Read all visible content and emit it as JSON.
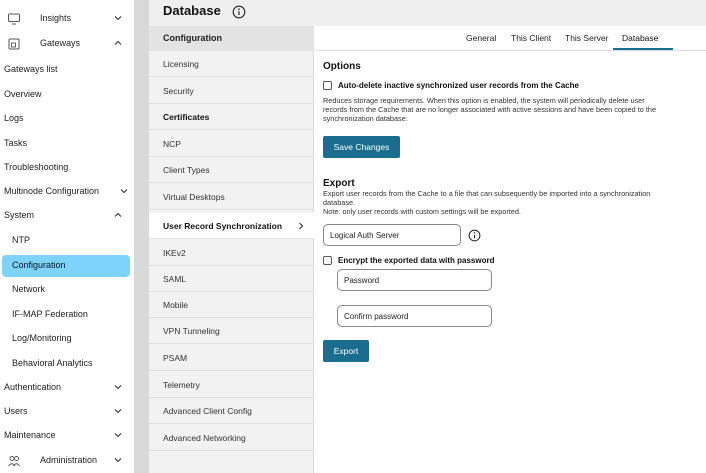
{
  "nav": {
    "items": [
      {
        "label": "Insights",
        "has_icon": true
      },
      {
        "label": "Gateways",
        "has_icon": true
      },
      {
        "label": "Gateways list"
      },
      {
        "label": "Overview"
      },
      {
        "label": "Logs"
      },
      {
        "label": "Tasks"
      },
      {
        "label": "Troubleshooting"
      },
      {
        "label": "Multinode Configuration"
      },
      {
        "label": "System"
      },
      {
        "label": "NTP"
      },
      {
        "label": "Configuration"
      },
      {
        "label": "Network"
      },
      {
        "label": "IF-MAP Federation"
      },
      {
        "label": "Log/Monitoring"
      },
      {
        "label": "Behavioral Analytics"
      },
      {
        "label": "Authentication"
      },
      {
        "label": "Users"
      },
      {
        "label": "Maintenance"
      },
      {
        "label": "Administration",
        "has_icon": true
      }
    ],
    "active_color": "#7dd3fc"
  },
  "header": {
    "title": "Database"
  },
  "config": {
    "heading": "Configuration",
    "items": [
      {
        "label": "Licensing"
      },
      {
        "label": "Security"
      },
      {
        "label": "Certificates"
      },
      {
        "label": "NCP"
      },
      {
        "label": "Client Types"
      },
      {
        "label": "Virtual Desktops"
      },
      {
        "label": "User Record Synchronization"
      },
      {
        "label": "IKEv2"
      },
      {
        "label": "SAML"
      },
      {
        "label": "Mobile"
      },
      {
        "label": "VPN Tunneling"
      },
      {
        "label": "PSAM"
      },
      {
        "label": "Telemetry"
      },
      {
        "label": "Advanced Client Config"
      },
      {
        "label": "Advanced Networking"
      }
    ]
  },
  "tabs": [
    {
      "label": "General"
    },
    {
      "label": "This Client"
    },
    {
      "label": "This Server"
    },
    {
      "label": "Database"
    }
  ],
  "options": {
    "title": "Options",
    "checkbox_label": "Auto-delete inactive synchronized user records from the Cache",
    "desc1": "Reduces storage requirements. When this option is enabled, the system will periodically delete user",
    "desc2": "records from the Cache that are no longer associated with active sessions and have been copied to the",
    "desc3": "synchronization database.",
    "save_label": "Save Changes"
  },
  "export": {
    "title": "Export",
    "desc1": "Export user records from the Cache to a file that can subsequently be imported into a synchronization",
    "desc2": "database.",
    "desc3": "Note: only user records with custom settings will be exported.",
    "server_value": "Logical Auth Server",
    "encrypt_label": "Encrypt the exported data with password",
    "password_label": "Password",
    "confirm_label": "Confirm password",
    "export_label": "Export"
  },
  "colors": {
    "accent": "#1a6d8f"
  }
}
